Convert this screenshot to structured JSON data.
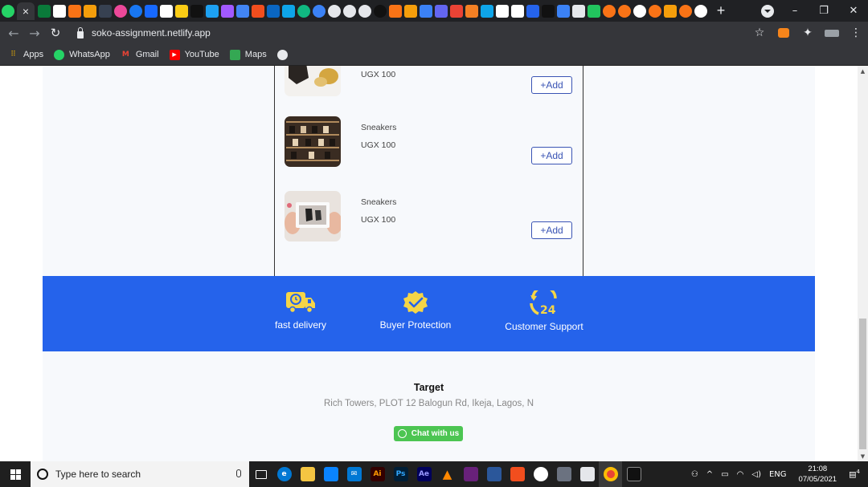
{
  "browser": {
    "active_tab_close": "×",
    "new_tab": "+",
    "url": "soko-assignment.netlify.app",
    "window_controls": {
      "minimize": "–",
      "maximize": "❐",
      "close": "✕"
    },
    "bookmarks": [
      {
        "label": "Apps",
        "icon": "apps-grid-icon",
        "color": "#f4b400"
      },
      {
        "label": "WhatsApp",
        "icon": "whatsapp-icon",
        "color": "#25d366"
      },
      {
        "label": "Gmail",
        "icon": "gmail-icon",
        "color": "#ea4335"
      },
      {
        "label": "YouTube",
        "icon": "youtube-icon",
        "color": "#ff0000"
      },
      {
        "label": "Maps",
        "icon": "maps-icon",
        "color": "#34a853"
      }
    ]
  },
  "products": [
    {
      "name": "",
      "price": "UGX 100",
      "add_label": "+Add"
    },
    {
      "name": "Sneakers",
      "price": "UGX 100",
      "add_label": "+Add"
    },
    {
      "name": "Sneakers",
      "price": "UGX 100",
      "add_label": "+Add"
    }
  ],
  "features": [
    {
      "label": "fast delivery",
      "icon": "delivery-truck-icon"
    },
    {
      "label": "Buyer Protection",
      "icon": "protection-badge-icon"
    },
    {
      "label": "Customer Support",
      "icon": "support-24-icon"
    }
  ],
  "footer": {
    "title": "Target",
    "address": "Rich Towers, PLOT 12 Balogun Rd, Ikeja, Lagos, N",
    "chat_label": "Chat with us"
  },
  "taskbar": {
    "search_placeholder": "Type here to search",
    "language": "ENG",
    "time": "21:08",
    "date": "07/05/2021",
    "notification_count": "4"
  },
  "colors": {
    "accent_blue": "#2563eb",
    "feature_icon_yellow": "#f5d547",
    "chat_green": "#4cc552",
    "add_button": "#3a54b4"
  }
}
